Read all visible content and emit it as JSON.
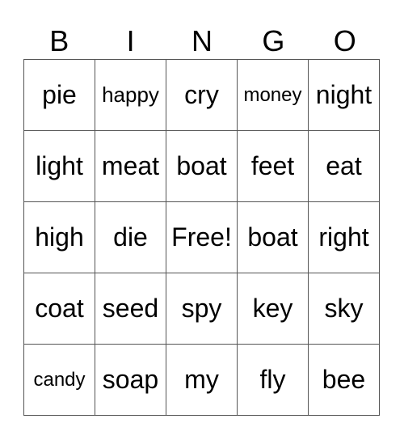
{
  "header": [
    "B",
    "I",
    "N",
    "G",
    "O"
  ],
  "cells": [
    [
      "pie",
      "happy",
      "cry",
      "money",
      "night"
    ],
    [
      "light",
      "meat",
      "boat",
      "feet",
      "eat"
    ],
    [
      "high",
      "die",
      "Free!",
      "boat",
      "right"
    ],
    [
      "coat",
      "seed",
      "spy",
      "key",
      "sky"
    ],
    [
      "candy",
      "soap",
      "my",
      "fly",
      "bee"
    ]
  ]
}
